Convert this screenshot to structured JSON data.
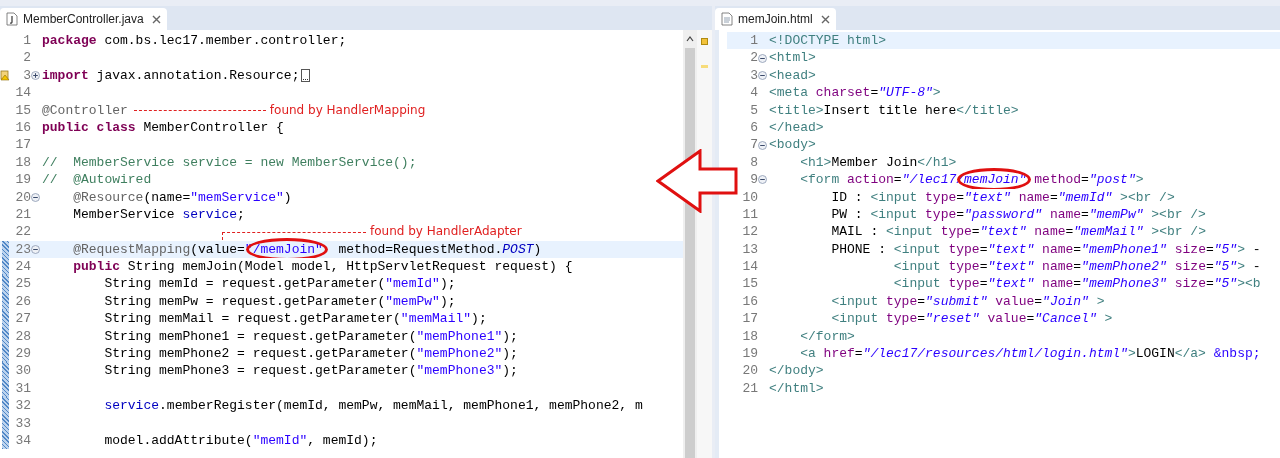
{
  "editors": [
    {
      "tab": {
        "title": "MemberController.java",
        "kind": "java"
      },
      "lines": [
        {
          "n": "1",
          "current": false,
          "changed": false,
          "tokens": [
            {
              "kind": "kw",
              "text": "package"
            },
            {
              "kind": "p",
              "text": " com.bs.lec17.member.controller;"
            }
          ]
        },
        {
          "n": "2",
          "current": false,
          "changed": false
        },
        {
          "n": "3",
          "current": false,
          "changed": false,
          "fold": {
            "kind": "expand"
          },
          "marker": {
            "kind": "warning"
          },
          "tokens": [
            {
              "kind": "kw",
              "text": "import"
            },
            {
              "kind": "p",
              "text": " javax.annotation.Resource;"
            }
          ]
        },
        {
          "n": "14",
          "current": false,
          "changed": false
        },
        {
          "n": "15",
          "current": false,
          "changed": false,
          "tokens": [
            {
              "kind": "ann",
              "text": "@Controller"
            }
          ],
          "note": {
            "kind": "trailing",
            "text": "found by HandlerMapping"
          }
        },
        {
          "n": "16",
          "current": false,
          "changed": false,
          "tokens": [
            {
              "kind": "kw",
              "text": "public"
            },
            {
              "kind": "kw",
              "text": " class"
            },
            {
              "kind": "p",
              "text": " MemberController {"
            }
          ]
        },
        {
          "n": "17",
          "current": false,
          "changed": false
        },
        {
          "n": "18",
          "current": false,
          "changed": false,
          "tokens": [
            {
              "kind": "cm",
              "text": "//  MemberService service = new MemberService();"
            }
          ]
        },
        {
          "n": "19",
          "current": false,
          "changed": false,
          "tokens": [
            {
              "kind": "cm",
              "text": "//  @Autowired"
            }
          ]
        },
        {
          "n": "20",
          "current": false,
          "changed": false,
          "fold": {
            "kind": "collapse"
          },
          "tokens": [
            {
              "kind": "ann",
              "text": "    @Resource"
            },
            {
              "kind": "p",
              "text": "(name="
            },
            {
              "kind": "str",
              "text": "\"memService\""
            },
            {
              "kind": "p",
              "text": ")"
            }
          ]
        },
        {
          "n": "21",
          "current": false,
          "changed": false,
          "tokens": [
            {
              "kind": "p",
              "text": "    MemberService "
            },
            {
              "kind": "field",
              "text": "service"
            },
            {
              "kind": "p",
              "text": ";"
            }
          ]
        },
        {
          "n": "22",
          "current": false,
          "changed": false,
          "note": {
            "kind": "hanging",
            "text": "found by HandlerAdapter"
          }
        },
        {
          "n": "23",
          "current": true,
          "changed": true,
          "fold": {
            "kind": "collapse"
          },
          "tokens": [
            {
              "kind": "ann",
              "text": "    @RequestMapping"
            },
            {
              "kind": "p",
              "text": "(value="
            },
            {
              "kind": "str",
              "text": "\""
            },
            {
              "kind": "str",
              "text": "/memJoin\"",
              "circled": true
            },
            {
              "kind": "p",
              "text": "  method=RequestMethod."
            },
            {
              "kind": "sfield",
              "text": "POST"
            },
            {
              "kind": "p",
              "text": ")"
            }
          ]
        },
        {
          "n": "24",
          "current": false,
          "changed": true,
          "tokens": [
            {
              "kind": "kw",
              "text": "    public"
            },
            {
              "kind": "p",
              "text": " String memJoin(Model model, HttpServletRequest request) {"
            }
          ]
        },
        {
          "n": "25",
          "current": false,
          "changed": true,
          "tokens": [
            {
              "kind": "p",
              "text": "        String memId = request.getParameter("
            },
            {
              "kind": "str",
              "text": "\"memId\""
            },
            {
              "kind": "p",
              "text": ");"
            }
          ]
        },
        {
          "n": "26",
          "current": false,
          "changed": true,
          "tokens": [
            {
              "kind": "p",
              "text": "        String memPw = request.getParameter("
            },
            {
              "kind": "str",
              "text": "\"memPw\""
            },
            {
              "kind": "p",
              "text": ");"
            }
          ]
        },
        {
          "n": "27",
          "current": false,
          "changed": true,
          "tokens": [
            {
              "kind": "p",
              "text": "        String memMail = request.getParameter("
            },
            {
              "kind": "str",
              "text": "\"memMail\""
            },
            {
              "kind": "p",
              "text": ");"
            }
          ]
        },
        {
          "n": "28",
          "current": false,
          "changed": true,
          "tokens": [
            {
              "kind": "p",
              "text": "        String memPhone1 = request.getParameter("
            },
            {
              "kind": "str",
              "text": "\"memPhone1\""
            },
            {
              "kind": "p",
              "text": ");"
            }
          ]
        },
        {
          "n": "29",
          "current": false,
          "changed": true,
          "tokens": [
            {
              "kind": "p",
              "text": "        String memPhone2 = request.getParameter("
            },
            {
              "kind": "str",
              "text": "\"memPhone2\""
            },
            {
              "kind": "p",
              "text": ");"
            }
          ]
        },
        {
          "n": "30",
          "current": false,
          "changed": true,
          "tokens": [
            {
              "kind": "p",
              "text": "        String memPhone3 = request.getParameter("
            },
            {
              "kind": "str",
              "text": "\"memPhone3\""
            },
            {
              "kind": "p",
              "text": ");"
            }
          ]
        },
        {
          "n": "31",
          "current": false,
          "changed": true
        },
        {
          "n": "32",
          "current": false,
          "changed": true,
          "tokens": [
            {
              "kind": "field",
              "text": "        service"
            },
            {
              "kind": "p",
              "text": ".memberRegister(memId, memPw, memMail, memPhone1, memPhone2, m"
            }
          ]
        },
        {
          "n": "33",
          "current": false,
          "changed": true
        },
        {
          "n": "34",
          "current": false,
          "changed": true,
          "tokens": [
            {
              "kind": "p",
              "text": "        model.addAttribute("
            },
            {
              "kind": "str",
              "text": "\"memId\""
            },
            {
              "kind": "p",
              "text": ", memId);"
            }
          ]
        }
      ]
    },
    {
      "tab": {
        "title": "memJoin.html",
        "kind": "html"
      },
      "lines": [
        {
          "n": "1",
          "current": true,
          "tokens": [
            {
              "kind": "tag",
              "text": "<!DOCTYPE html>"
            }
          ]
        },
        {
          "n": "2",
          "current": false,
          "fold": {
            "kind": "collapse"
          },
          "tokens": [
            {
              "kind": "tag",
              "text": "<html>"
            }
          ]
        },
        {
          "n": "3",
          "current": false,
          "fold": {
            "kind": "collapse"
          },
          "tokens": [
            {
              "kind": "tag",
              "text": "<head>"
            }
          ]
        },
        {
          "n": "4",
          "current": false,
          "tokens": [
            {
              "kind": "tag",
              "text": "<meta"
            },
            {
              "kind": "attr",
              "text": " charset"
            },
            {
              "kind": "p",
              "text": "="
            },
            {
              "kind": "val",
              "text": "\"UTF-8\""
            },
            {
              "kind": "tag",
              "text": ">"
            }
          ]
        },
        {
          "n": "5",
          "current": false,
          "tokens": [
            {
              "kind": "tag",
              "text": "<title>"
            },
            {
              "kind": "p",
              "text": "Insert title here"
            },
            {
              "kind": "tag",
              "text": "</title>"
            }
          ]
        },
        {
          "n": "6",
          "current": false,
          "tokens": [
            {
              "kind": "tag",
              "text": "</head>"
            }
          ]
        },
        {
          "n": "7",
          "current": false,
          "fold": {
            "kind": "collapse"
          },
          "tokens": [
            {
              "kind": "tag",
              "text": "<body>"
            }
          ]
        },
        {
          "n": "8",
          "current": false,
          "tokens": [
            {
              "kind": "tag",
              "text": "    <h1>"
            },
            {
              "kind": "p",
              "text": "Member Join"
            },
            {
              "kind": "tag",
              "text": "</h1>"
            }
          ]
        },
        {
          "n": "9",
          "current": false,
          "fold": {
            "kind": "collapse"
          },
          "tokens": [
            {
              "kind": "tag",
              "text": "    <form"
            },
            {
              "kind": "attr",
              "text": " action"
            },
            {
              "kind": "p",
              "text": "="
            },
            {
              "kind": "val",
              "text": "\"/lec17/"
            },
            {
              "kind": "val",
              "text": "memJoin\"",
              "circled": true
            },
            {
              "kind": "attr",
              "text": " method"
            },
            {
              "kind": "p",
              "text": "="
            },
            {
              "kind": "val",
              "text": "\"post\""
            },
            {
              "kind": "tag",
              "text": ">"
            }
          ]
        },
        {
          "n": "10",
          "current": false,
          "tokens": [
            {
              "kind": "p",
              "text": "        ID : "
            },
            {
              "kind": "tag",
              "text": "<input"
            },
            {
              "kind": "attr",
              "text": " type"
            },
            {
              "kind": "p",
              "text": "="
            },
            {
              "kind": "val",
              "text": "\"text\""
            },
            {
              "kind": "attr",
              "text": " name"
            },
            {
              "kind": "p",
              "text": "="
            },
            {
              "kind": "val",
              "text": "\"memId\""
            },
            {
              "kind": "tag",
              "text": " ><br />"
            }
          ]
        },
        {
          "n": "11",
          "current": false,
          "tokens": [
            {
              "kind": "p",
              "text": "        PW : "
            },
            {
              "kind": "tag",
              "text": "<input"
            },
            {
              "kind": "attr",
              "text": " type"
            },
            {
              "kind": "p",
              "text": "="
            },
            {
              "kind": "val",
              "text": "\"password\""
            },
            {
              "kind": "attr",
              "text": " name"
            },
            {
              "kind": "p",
              "text": "="
            },
            {
              "kind": "val",
              "text": "\"memPw\""
            },
            {
              "kind": "tag",
              "text": " ><br />"
            }
          ]
        },
        {
          "n": "12",
          "current": false,
          "tokens": [
            {
              "kind": "p",
              "text": "        MAIL : "
            },
            {
              "kind": "tag",
              "text": "<input"
            },
            {
              "kind": "attr",
              "text": " type"
            },
            {
              "kind": "p",
              "text": "="
            },
            {
              "kind": "val",
              "text": "\"text\""
            },
            {
              "kind": "attr",
              "text": " name"
            },
            {
              "kind": "p",
              "text": "="
            },
            {
              "kind": "val",
              "text": "\"memMail\""
            },
            {
              "kind": "tag",
              "text": " ><br />"
            }
          ]
        },
        {
          "n": "13",
          "current": false,
          "tokens": [
            {
              "kind": "p",
              "text": "        PHONE : "
            },
            {
              "kind": "tag",
              "text": "<input"
            },
            {
              "kind": "attr",
              "text": " type"
            },
            {
              "kind": "p",
              "text": "="
            },
            {
              "kind": "val",
              "text": "\"text\""
            },
            {
              "kind": "attr",
              "text": " name"
            },
            {
              "kind": "p",
              "text": "="
            },
            {
              "kind": "val",
              "text": "\"memPhone1\""
            },
            {
              "kind": "attr",
              "text": " size"
            },
            {
              "kind": "p",
              "text": "="
            },
            {
              "kind": "val",
              "text": "\"5\""
            },
            {
              "kind": "tag",
              "text": ">"
            },
            {
              "kind": "p",
              "text": " -"
            }
          ]
        },
        {
          "n": "14",
          "current": false,
          "tokens": [
            {
              "kind": "tag",
              "text": "                <input"
            },
            {
              "kind": "attr",
              "text": " type"
            },
            {
              "kind": "p",
              "text": "="
            },
            {
              "kind": "val",
              "text": "\"text\""
            },
            {
              "kind": "attr",
              "text": " name"
            },
            {
              "kind": "p",
              "text": "="
            },
            {
              "kind": "val",
              "text": "\"memPhone2\""
            },
            {
              "kind": "attr",
              "text": " size"
            },
            {
              "kind": "p",
              "text": "="
            },
            {
              "kind": "val",
              "text": "\"5\""
            },
            {
              "kind": "tag",
              "text": ">"
            },
            {
              "kind": "p",
              "text": " -"
            }
          ]
        },
        {
          "n": "15",
          "current": false,
          "tokens": [
            {
              "kind": "tag",
              "text": "                <input"
            },
            {
              "kind": "attr",
              "text": " type"
            },
            {
              "kind": "p",
              "text": "="
            },
            {
              "kind": "val",
              "text": "\"text\""
            },
            {
              "kind": "attr",
              "text": " name"
            },
            {
              "kind": "p",
              "text": "="
            },
            {
              "kind": "val",
              "text": "\"memPhone3\""
            },
            {
              "kind": "attr",
              "text": " size"
            },
            {
              "kind": "p",
              "text": "="
            },
            {
              "kind": "val",
              "text": "\"5\""
            },
            {
              "kind": "tag",
              "text": "><b"
            }
          ]
        },
        {
          "n": "16",
          "current": false,
          "tokens": [
            {
              "kind": "tag",
              "text": "        <input"
            },
            {
              "kind": "attr",
              "text": " type"
            },
            {
              "kind": "p",
              "text": "="
            },
            {
              "kind": "val",
              "text": "\"submit\""
            },
            {
              "kind": "attr",
              "text": " value"
            },
            {
              "kind": "p",
              "text": "="
            },
            {
              "kind": "val",
              "text": "\"Join\""
            },
            {
              "kind": "tag",
              "text": " >"
            }
          ]
        },
        {
          "n": "17",
          "current": false,
          "tokens": [
            {
              "kind": "tag",
              "text": "        <input"
            },
            {
              "kind": "attr",
              "text": " type"
            },
            {
              "kind": "p",
              "text": "="
            },
            {
              "kind": "val",
              "text": "\"reset\""
            },
            {
              "kind": "attr",
              "text": " value"
            },
            {
              "kind": "p",
              "text": "="
            },
            {
              "kind": "val",
              "text": "\"Cancel\""
            },
            {
              "kind": "tag",
              "text": " >"
            }
          ]
        },
        {
          "n": "18",
          "current": false,
          "tokens": [
            {
              "kind": "tag",
              "text": "    </form>"
            }
          ]
        },
        {
          "n": "19",
          "current": false,
          "tokens": [
            {
              "kind": "tag",
              "text": "    <a"
            },
            {
              "kind": "attr",
              "text": " href"
            },
            {
              "kind": "p",
              "text": "="
            },
            {
              "kind": "val",
              "text": "\"/lec17/resources/html/login.html\""
            },
            {
              "kind": "tag",
              "text": ">"
            },
            {
              "kind": "p",
              "text": "LOGIN"
            },
            {
              "kind": "tag",
              "text": "</a>"
            },
            {
              "kind": "ent",
              "text": " &nbsp;"
            }
          ]
        },
        {
          "n": "20",
          "current": false,
          "tokens": [
            {
              "kind": "tag",
              "text": "</body>"
            }
          ]
        },
        {
          "n": "21",
          "current": false,
          "tokens": [
            {
              "kind": "tag",
              "text": "</html>"
            }
          ]
        }
      ]
    }
  ]
}
